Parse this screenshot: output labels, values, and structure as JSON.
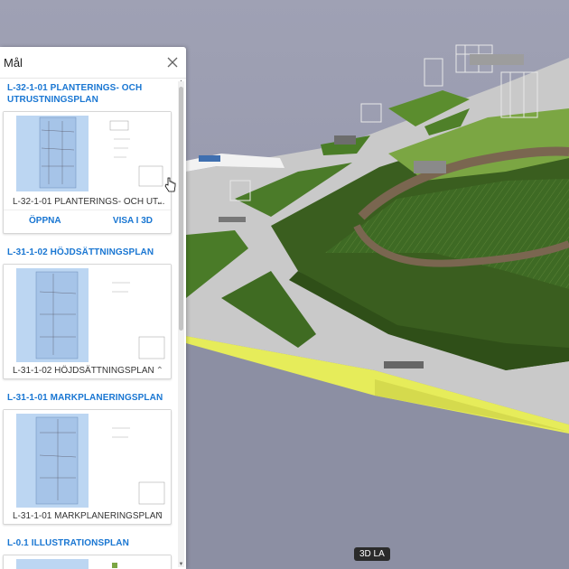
{
  "panel": {
    "title": "Mål",
    "close_icon": "close-icon",
    "plans": [
      {
        "heading": "L-32-1-01 PLANTERINGS- OCH UTRUSTNINGSPLAN",
        "caption": "L-32-1-01 PLANTERINGS- OCH UT...",
        "caption_icon": "chevron-down-icon",
        "open_label": "ÖPPNA",
        "view3d_label": "VISA I 3D"
      },
      {
        "heading": "L-31-1-02 HÖJDSÄTTNINGSPLAN",
        "caption": "L-31-1-02 HÖJDSÄTTNINGSPLAN",
        "caption_icon": "chevron-up-icon"
      },
      {
        "heading": "L-31-1-01 MARKPLANERINGSPLAN",
        "caption": "L-31-1-01 MARKPLANERINGSPLAN",
        "caption_icon": "chevron-up-icon"
      },
      {
        "heading": "L-0.1 ILLUSTRATIONSPLAN"
      }
    ]
  },
  "viewport": {
    "badge": "3D LA"
  },
  "cursor_icon": "hand-pointer-icon"
}
